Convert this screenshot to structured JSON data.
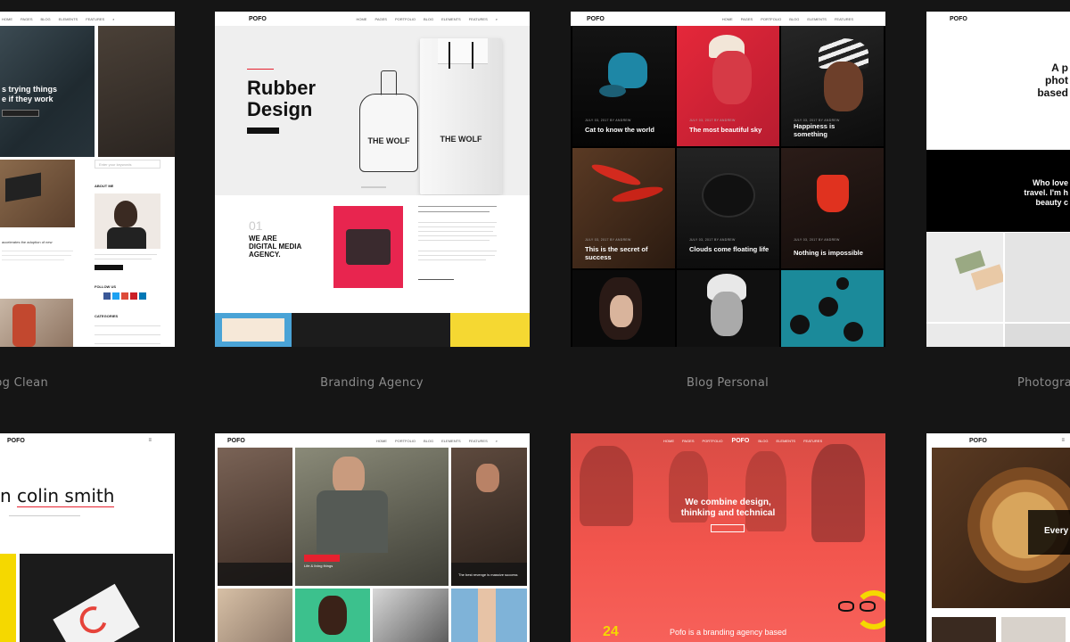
{
  "captions": {
    "blog_clean": "og Clean",
    "branding_agency": "Branding Agency",
    "blog_personal": "Blog Personal",
    "photography": "Photogra"
  },
  "blog_clean": {
    "hero_text": "s trying things\ne if they work",
    "post_text": "accelerates the adoption of new",
    "about_label": "ABOUT ME",
    "follow_label": "FOLLOW US",
    "categories_label": "CATEGORIES",
    "search_placeholder": "Enter your keywords"
  },
  "branding": {
    "logo": "POFO",
    "title_line1": "Rubber",
    "title_line2": "Design",
    "bottle_label": "THE WOLF",
    "bag_label": "THE WOLF",
    "number": "01",
    "agency_text": "WE ARE\nDIGITAL MEDIA\nAGENCY.",
    "nav": [
      "HOME",
      "PAGES",
      "PORTFOLIO",
      "BLOG",
      "ELEMENTS",
      "FEATURES"
    ]
  },
  "blog_personal": {
    "logo": "POFO",
    "posts": [
      "Cat to know the world",
      "The most beautiful sky",
      "Happiness is something",
      "This is the secret of success",
      "Clouds come floating life",
      "Nothing is impossible"
    ]
  },
  "photography": {
    "logo": "POFO",
    "hero_text": "A p\nphot\nbased",
    "dark_text": "Who love\ntravel. I'm h\nbeauty c"
  },
  "colin": {
    "logo": "POFO",
    "name": "colin smith",
    "name_prefix": "n"
  },
  "magazine": {
    "logo": "POFO",
    "posts": [
      "Life & living things",
      "The best revenge is massive success"
    ]
  },
  "agency_red": {
    "logo": "POFO",
    "headline_line1": "We combine design,",
    "headline_line2": "thinking and technical",
    "footer_text": "Pofo is a branding agency based",
    "number": "24"
  },
  "food": {
    "logo": "POFO",
    "overlay_text": "Every\n"
  },
  "colors": {
    "background": "#151515",
    "accent_red": "#e6212e",
    "coral": "#f2554d"
  }
}
